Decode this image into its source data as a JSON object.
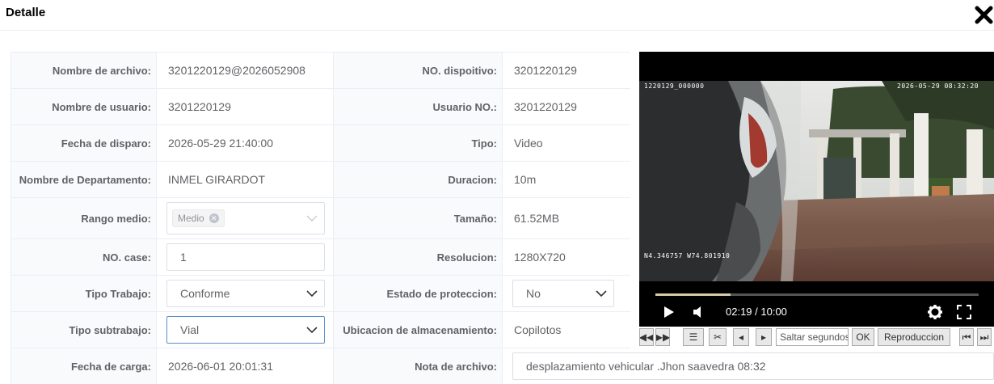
{
  "dialog": {
    "title": "Detalle",
    "close_icon": "close-x-icon"
  },
  "rows": [
    {
      "l1": "Nombre de archivo:",
      "v1": "3201220129@2026052908",
      "l2": "NO. dispoitivo:",
      "v2": "3201220129"
    },
    {
      "l1": "Nombre de usuario:",
      "v1": "3201220129",
      "l2": "Usuario NO.:",
      "v2": "3201220129"
    },
    {
      "l1": "Fecha de disparo:",
      "v1": "2026-05-29 21:40:00",
      "l2": "Tipo:",
      "v2": "Video"
    },
    {
      "l1": "Nombre de Departamento:",
      "v1": "INMEL GIRARDOT",
      "l2": "Duracion:",
      "v2": "10m"
    },
    {
      "l1": "Rango medio:",
      "v1_tag": "Medio",
      "l2": "Tamaño:",
      "v2": "61.52MB"
    },
    {
      "l1": "NO. case:",
      "v1_input": "1",
      "l2": "Resolucion:",
      "v2": "1280X720"
    },
    {
      "l1": "Tipo Trabajo:",
      "v1_select": "Conforme",
      "l2": "Estado de proteccion:",
      "v2_select": "No"
    },
    {
      "l1": "Tipo subtrabajo:",
      "v1_select": "Vial",
      "l2": "Ubicacion de almacenamiento:",
      "v2": "Copilotos"
    },
    {
      "l1": "Fecha de carga:",
      "v1": "2026-06-01 20:01:31",
      "l2": "Nota de archivo:",
      "v2_input": "desplazamiento vehicular .Jhon saavedra 08:32"
    }
  ],
  "video": {
    "osd_top_left": "1220129_000000",
    "osd_top_right": "2026-05-29 08:32:20",
    "osd_bottom_left": "N4.346757  W74.801910",
    "time": "02:19 / 10:00",
    "progress": 0.232
  },
  "toolbar": {
    "seek_placeholder": "Saltar segundos",
    "ok_label": "OK",
    "reproduccion_label": "Reproduccion"
  }
}
